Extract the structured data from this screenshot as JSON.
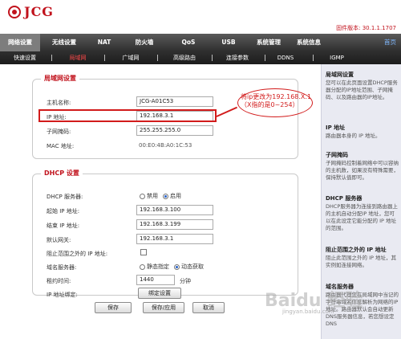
{
  "brand": {
    "name": "JCG",
    "firmware": "固件版本: 30.1.1.1707"
  },
  "nav": {
    "items": [
      "网络设置",
      "无线设置",
      "NAT",
      "防火墙",
      "QoS",
      "USB",
      "系统管理",
      "系统信息"
    ],
    "home": "首页"
  },
  "subnav": {
    "items": [
      "快速设置",
      "局域网",
      "广域网",
      "高级路由",
      "连接参数",
      "DDNS",
      "IGMP"
    ]
  },
  "lan": {
    "legend": "局域网设置",
    "hostname_label": "主机名称:",
    "hostname_value": "JCG-A01C53",
    "ip_label": "IP 地址:",
    "ip_value": "192.168.3.1",
    "mask_label": "子网掩码:",
    "mask_value": "255.255.255.0",
    "mac_label": "MAC 地址:",
    "mac_value": "00:E0:4B:A0:1C:53"
  },
  "annotation": {
    "text": "将ip更改为192.168.X.1（X指的是0~254）"
  },
  "dhcp": {
    "legend": "DHCP 设置",
    "server_label": "DHCP 服务器:",
    "server_options": [
      "禁用",
      "启用"
    ],
    "start_label": "起始 IP 地址:",
    "start_value": "192.168.3.100",
    "end_label": "结束 IP 地址:",
    "end_value": "192.168.3.199",
    "gateway_label": "默认网关:",
    "gateway_value": "192.168.3.1",
    "block_label": "阻止范围之外的 IP 地址:",
    "dns_label": "域名服务器:",
    "dns_options": [
      "静态指定",
      "动态获取"
    ],
    "lease_label": "租约时间:",
    "lease_value": "1440",
    "lease_unit": "分钟",
    "bind_label": "IP 地址绑定:",
    "bind_button": "绑定设置"
  },
  "actions": {
    "save": "保存",
    "save_apply": "保存/应用",
    "cancel": "取消"
  },
  "sidebar": {
    "sections": [
      {
        "title": "局域网设置",
        "text": "您可以在此页面设置DHCP服务器分配的IP地址范围、子网掩码、以及路由器的IP地址。"
      },
      {
        "title": "IP 地址",
        "text": "路由器本身的 IP 地址。"
      },
      {
        "title": "子网掩码",
        "text": "子网掩码控制着网络中可以容纳的主机数，如果没有特殊需要，保持默认值即可。"
      },
      {
        "title": "DHCP 服务器",
        "text": "DHCP服务器为连接到路由器上的主机自动分配IP 地址，您可以在此设定它能分配的 IP 地址的范围。"
      },
      {
        "title": "阻止范围之外的 IP 地址",
        "text": "阻止此范围之外的 IP 地址，其实例如连接网络。"
      },
      {
        "title": "域名服务器",
        "text": "路由器代理您在局域网中当记的字符串域名信息解析为网络的IP地址。路由器默认会自动更新 DNS服务器信息，若您想设定 DNS"
      }
    ]
  },
  "watermark": {
    "text": "Baidu 经验",
    "sub": "jingyan.baidu.com"
  }
}
